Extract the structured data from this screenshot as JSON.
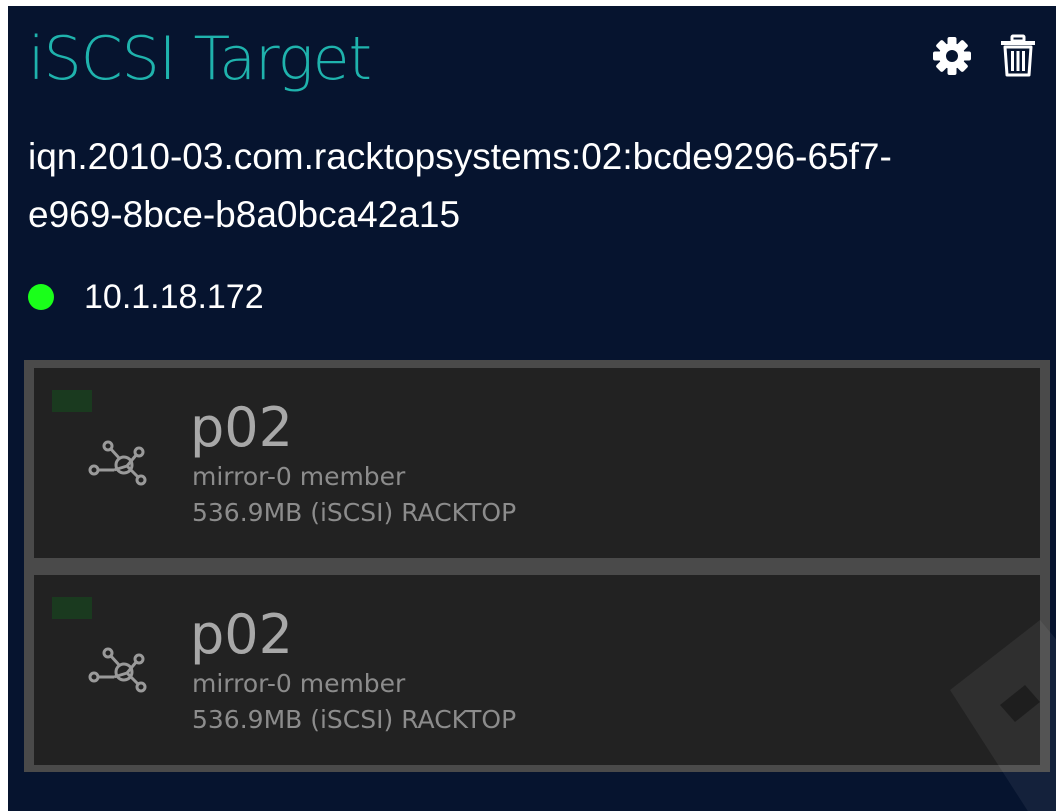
{
  "header": {
    "title": "iSCSI Target",
    "title_color": "#1fb3ad",
    "settings_icon": "gear-icon",
    "delete_icon": "trash-icon"
  },
  "target": {
    "iqn_line1": "iqn.2010-03.com.racktopsystems:02:bcde9296-65f7-",
    "iqn_line2": "e969-8bce-b8a0bca42a15",
    "status_color": "#1aff1a",
    "ip": "10.1.18.172"
  },
  "disks": [
    {
      "name": "p02",
      "role": "mirror-0 member",
      "detail": "536.9MB (iSCSI) RACKTOP",
      "icon": "network-nodes-icon",
      "tag_color": "#1a3a1f"
    },
    {
      "name": "p02",
      "role": "mirror-0 member",
      "detail": "536.9MB (iSCSI) RACKTOP",
      "icon": "network-nodes-icon",
      "tag_color": "#1a3a1f"
    }
  ],
  "colors": {
    "panel_bg": "#06142f",
    "card_bg": "#222222",
    "card_border": "#4a4a4a",
    "muted_text": "#8c8c8c"
  }
}
